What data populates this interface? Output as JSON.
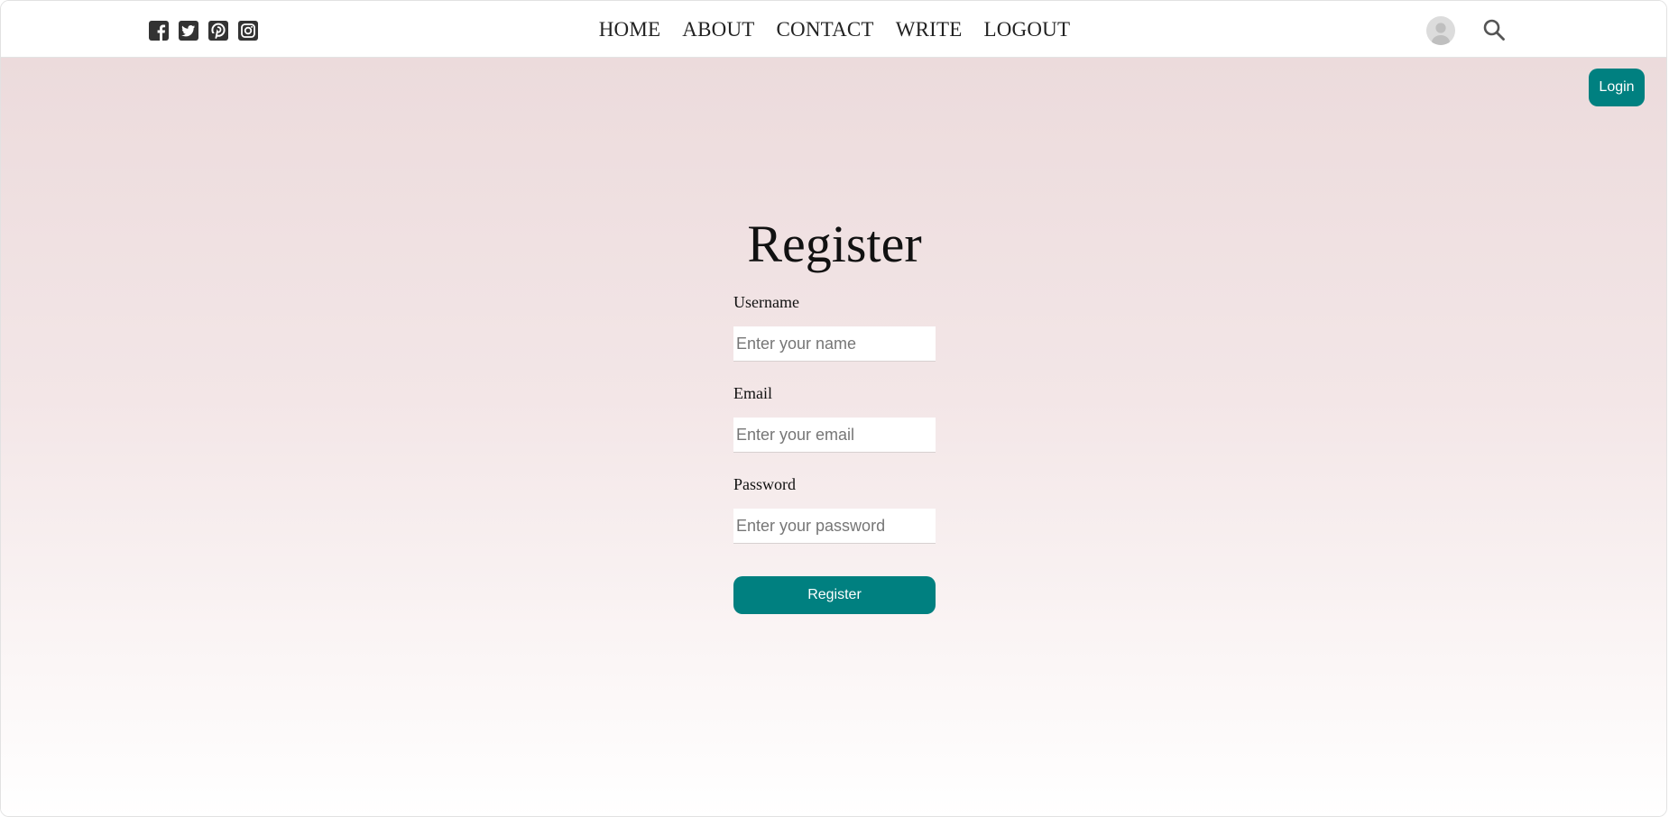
{
  "social": {
    "icons": [
      "facebook-square-icon",
      "twitter-square-icon",
      "pinterest-square-icon",
      "instagram-square-icon"
    ],
    "icon_color": "#333333"
  },
  "nav": {
    "items": [
      {
        "label": "HOME"
      },
      {
        "label": "ABOUT"
      },
      {
        "label": "CONTACT"
      },
      {
        "label": "WRITE"
      },
      {
        "label": "LOGOUT"
      }
    ]
  },
  "header_right": {
    "avatar_icon": "user-avatar-icon",
    "search_icon": "search-icon"
  },
  "login_button": {
    "label": "Login"
  },
  "register_form": {
    "title": "Register",
    "username": {
      "label": "Username",
      "placeholder": "Enter your name",
      "value": ""
    },
    "email": {
      "label": "Email",
      "placeholder": "Enter your email",
      "value": ""
    },
    "password": {
      "label": "Password",
      "placeholder": "Enter your password",
      "value": ""
    },
    "submit_label": "Register"
  },
  "colors": {
    "accent": "#008080",
    "background_top": "#ecdbdc",
    "background_bottom": "#ffffff"
  }
}
